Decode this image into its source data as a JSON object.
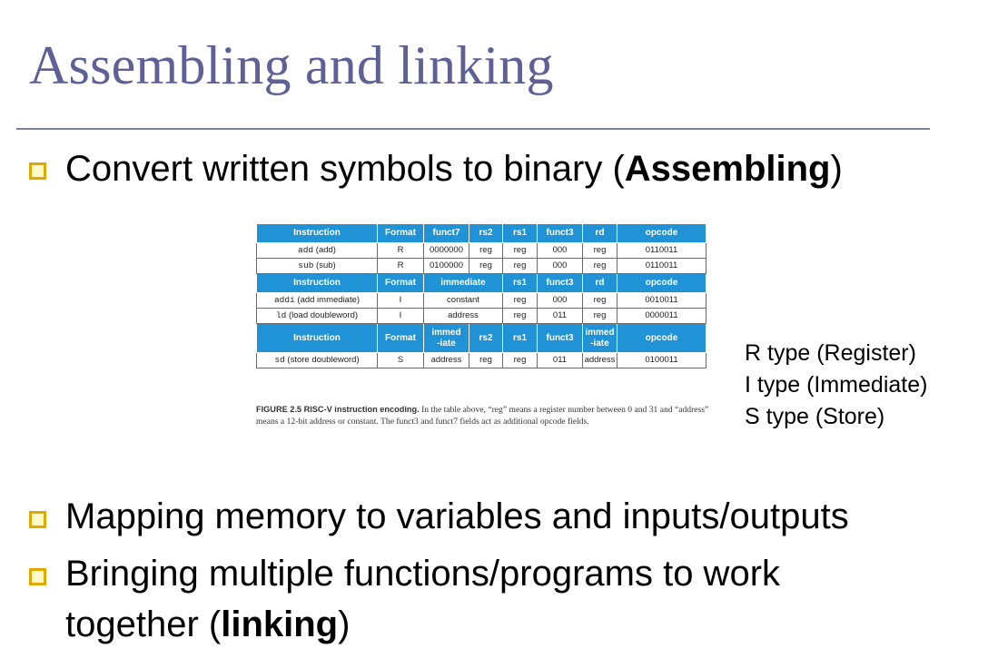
{
  "title": "Assembling and linking",
  "bullets": [
    {
      "pre": "Convert written symbols to binary (",
      "bold": "Assembling",
      "post": ")"
    },
    {
      "text": "Mapping memory to variables and inputs/outputs"
    },
    {
      "line1": "Bringing multiple functions/programs to work",
      "pre": "together (",
      "bold": "linking",
      "post": ")"
    }
  ],
  "figure": {
    "headers_r": [
      "Instruction",
      "Format",
      "funct7",
      "rs2",
      "rs1",
      "funct3",
      "rd",
      "opcode"
    ],
    "rows_r": [
      {
        "mnemonic": "add",
        "desc": "(add)",
        "cells": [
          "R",
          "0000000",
          "reg",
          "reg",
          "000",
          "reg",
          "0110011"
        ]
      },
      {
        "mnemonic": "sub",
        "desc": "(sub)",
        "cells": [
          "R",
          "0100000",
          "reg",
          "reg",
          "000",
          "reg",
          "0110011"
        ]
      }
    ],
    "headers_i": [
      "Instruction",
      "Format",
      "immediate",
      "rs1",
      "funct3",
      "rd",
      "opcode"
    ],
    "rows_i": [
      {
        "mnemonic": "addi",
        "desc": "(add immediate)",
        "cells": [
          "I",
          "constant",
          "reg",
          "000",
          "reg",
          "0010011"
        ]
      },
      {
        "mnemonic": "ld",
        "desc": "(load doubleword)",
        "cells": [
          "I",
          "address",
          "reg",
          "011",
          "reg",
          "0000011"
        ]
      }
    ],
    "headers_s": [
      "Instruction",
      "Format",
      "immed\n-iate",
      "rs2",
      "rs1",
      "funct3",
      "immed\n-iate",
      "opcode"
    ],
    "rows_s": [
      {
        "mnemonic": "sd",
        "desc": "(store doubleword)",
        "cells": [
          "S",
          "address",
          "reg",
          "reg",
          "011",
          "address",
          "0100011"
        ]
      }
    ],
    "caption_label": "FIGURE 2.5   RISC-V instruction encoding.",
    "caption_text": " In the table above, “reg” means a register number between 0 and 31 and “address” means a 12-bit address or constant. The funct3 and funct7 fields act as additional opcode fields."
  },
  "side_notes": [
    "R type (Register)",
    "I type (Immediate)",
    "S type (Store)"
  ],
  "colors": {
    "title": "#5f6096",
    "table_header": "#1f93d6",
    "bullet_border": "#e2a800"
  }
}
